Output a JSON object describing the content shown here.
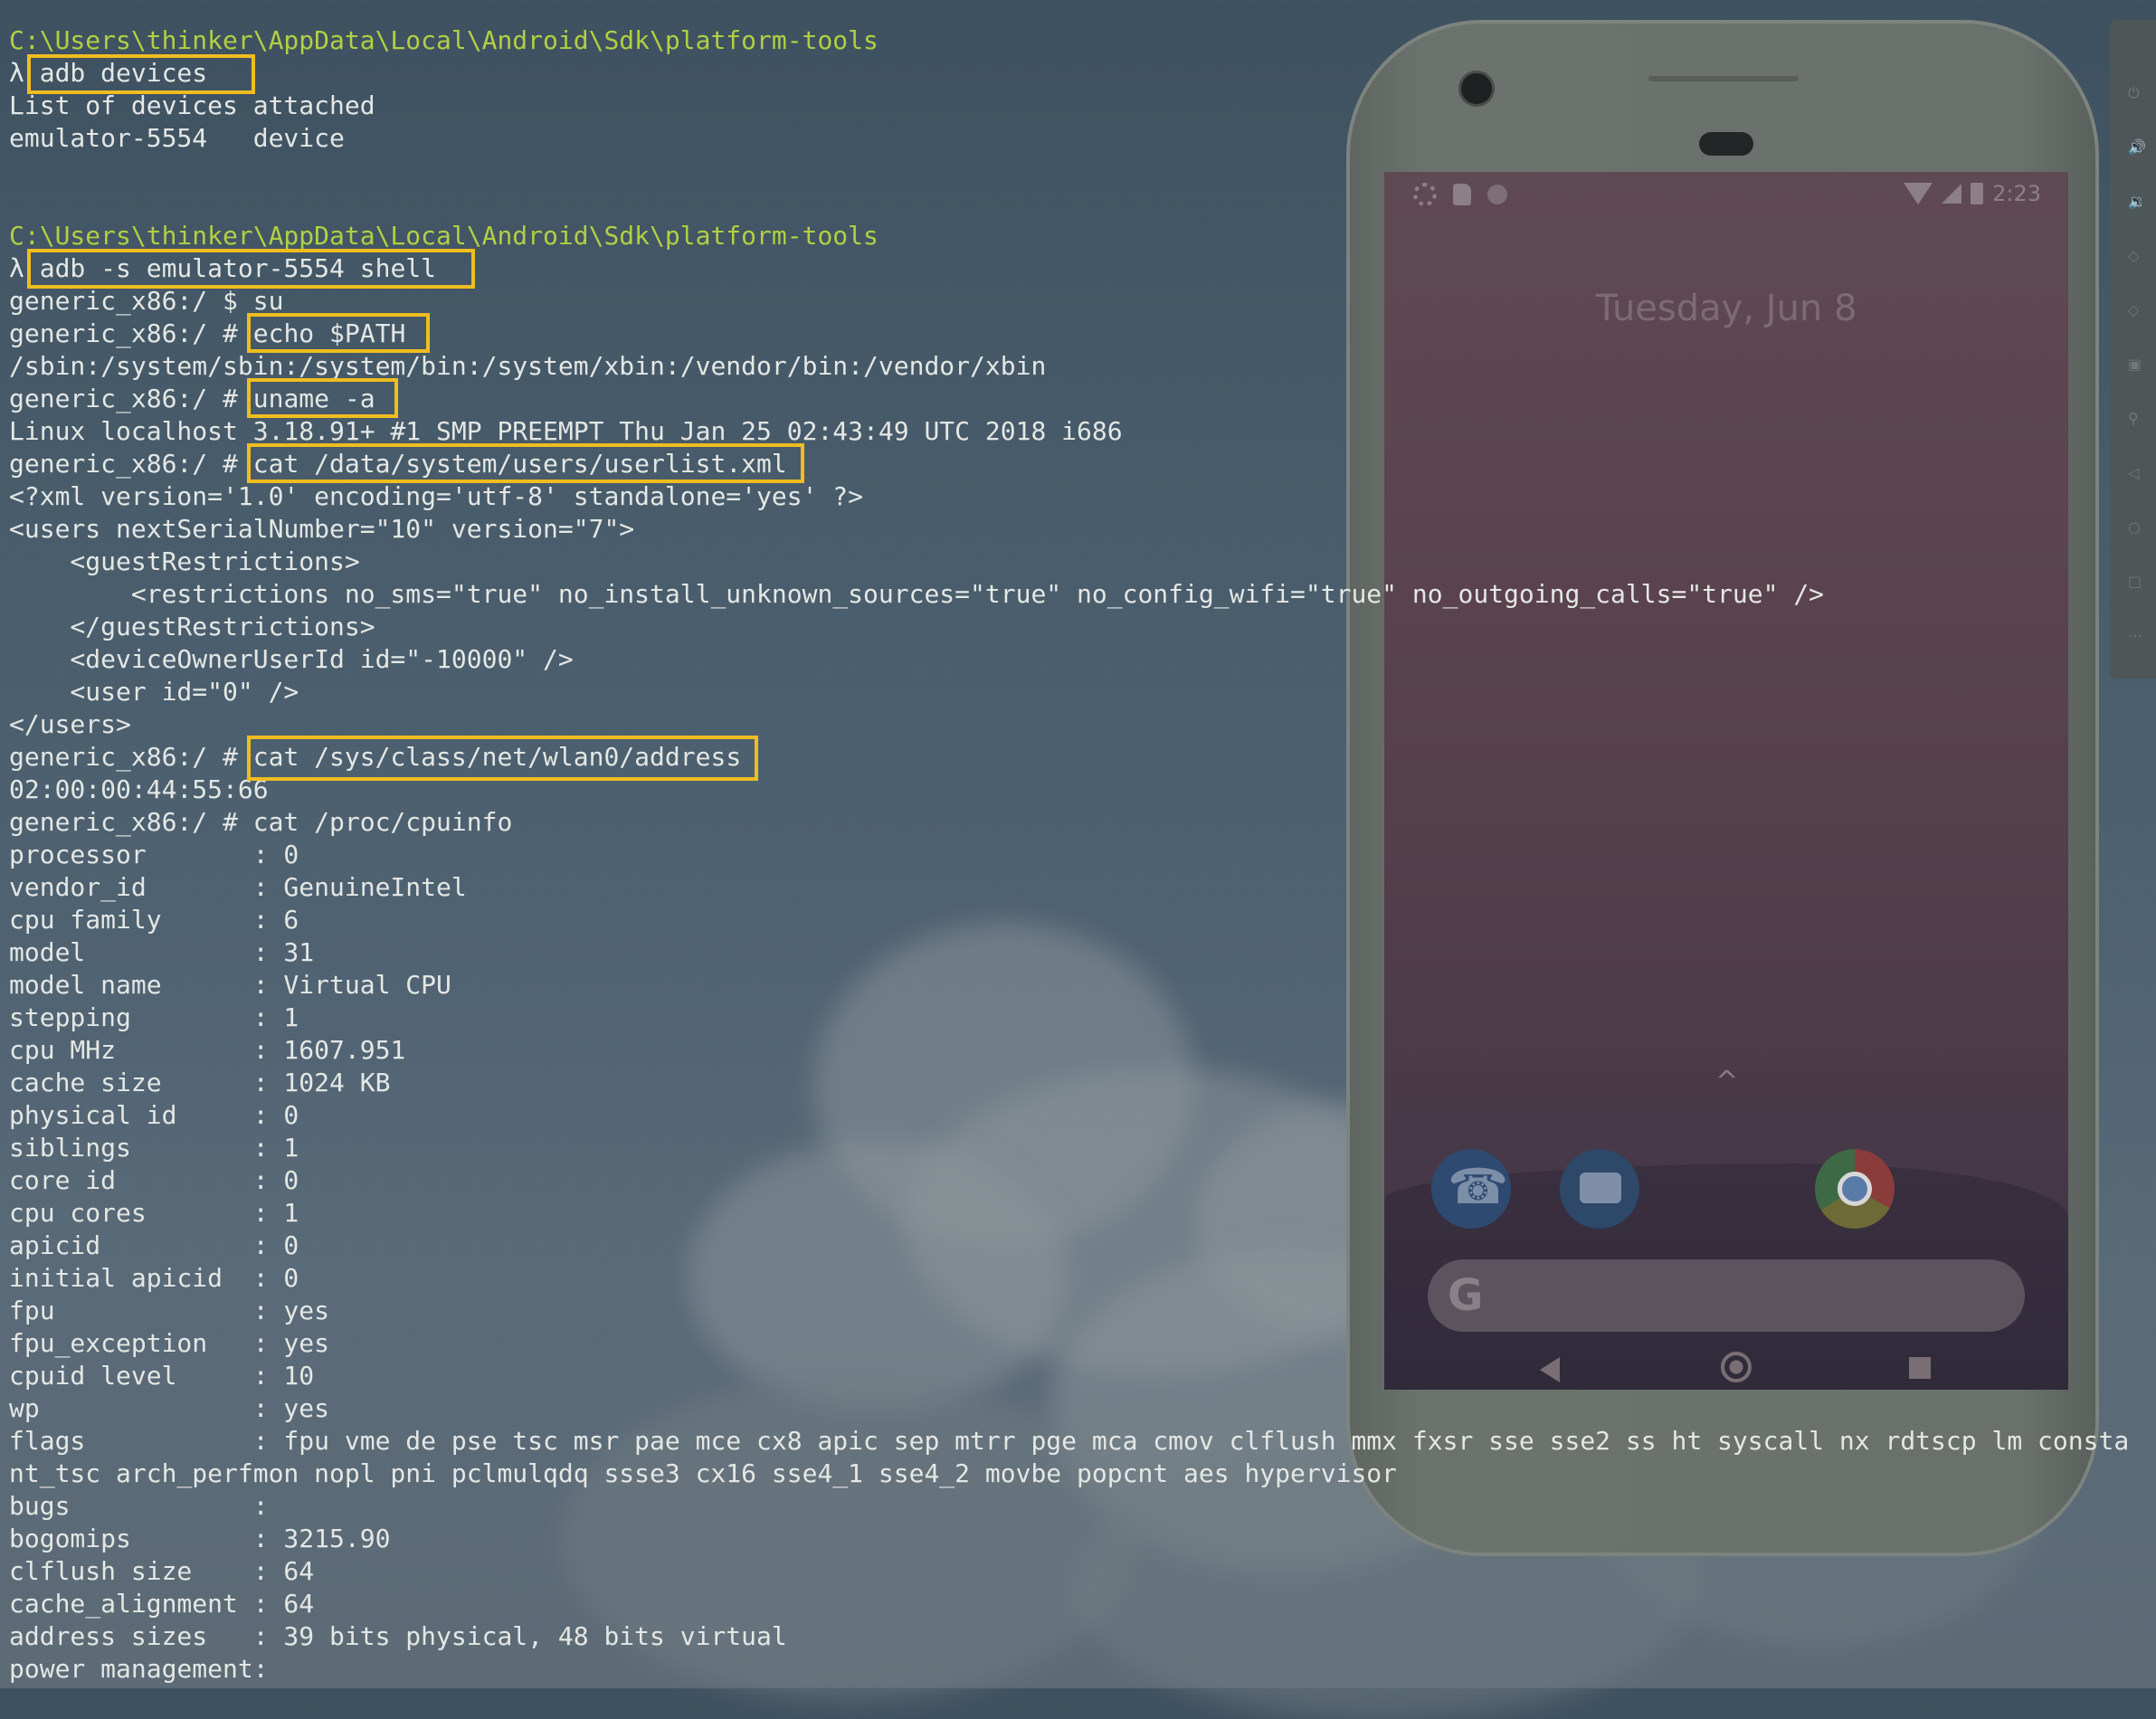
{
  "terminal": {
    "prompt_path": "C:\\Users\\thinker\\AppData\\Local\\Android\\Sdk\\platform-tools",
    "lambda": "λ",
    "commands": {
      "adb_devices": "adb devices",
      "adb_shell": "adb -s emulator-5554 shell",
      "echo_path": "echo $PATH",
      "uname": "uname -a",
      "cat_userlist": "cat /data/system/users/userlist.xml",
      "cat_wlan": "cat /sys/class/net/wlan0/address"
    },
    "prompts": {
      "user": "generic_x86:/ $ su",
      "root": "generic_x86:/ #"
    },
    "output": {
      "devices_header": "List of devices attached",
      "devices_row": "emulator-5554   device",
      "path_value": "/sbin:/system/sbin:/system/bin:/system/xbin:/vendor/bin:/vendor/xbin",
      "uname_value": "Linux localhost 3.18.91+ #1 SMP PREEMPT Thu Jan 25 02:43:49 UTC 2018 i686",
      "xml_lines": [
        "<?xml version='1.0' encoding='utf-8' standalone='yes' ?>",
        "<users nextSerialNumber=\"10\" version=\"7\">",
        "    <guestRestrictions>",
        "        <restrictions no_sms=\"true\" no_install_unknown_sources=\"true\" no_config_wifi=\"true\" no_outgoing_calls=\"true\" />",
        "    </guestRestrictions>",
        "    <deviceOwnerUserId id=\"-10000\" />",
        "    <user id=\"0\" />",
        "</users>"
      ],
      "mac_address": "02:00:00:44:55:66",
      "cpuinfo_cmd": "generic_x86:/ # cat /proc/cpuinfo",
      "cpuinfo_lines": [
        "processor       : 0",
        "vendor_id       : GenuineIntel",
        "cpu family      : 6",
        "model           : 31",
        "model name      : Virtual CPU",
        "stepping        : 1",
        "cpu MHz         : 1607.951",
        "cache size      : 1024 KB",
        "physical id     : 0",
        "siblings        : 1",
        "core id         : 0",
        "cpu cores       : 1",
        "apicid          : 0",
        "initial apicid  : 0",
        "fpu             : yes",
        "fpu_exception   : yes",
        "cpuid level     : 10",
        "wp              : yes",
        "flags           : fpu vme de pse tsc msr pae mce cx8 apic sep mtrr pge mca cmov clflush mmx fxsr sse sse2 ss ht syscall nx rdtscp lm consta",
        "nt_tsc arch_perfmon nopl pni pclmulqdq ssse3 cx16 sse4_1 sse4_2 movbe popcnt aes hypervisor",
        "bugs            :",
        "bogomips        : 3215.90",
        "clflush size    : 64",
        "cache_alignment : 64",
        "address sizes   : 39 bits physical, 48 bits virtual",
        "power management:"
      ]
    }
  },
  "emulator": {
    "status_time": "2:23",
    "lock_date": "Tuesday, Jun 8",
    "caret": "^",
    "search_logo": "G",
    "icons": [
      "phone-icon",
      "messages-icon",
      "chrome-icon",
      "google-search-icon",
      "back-icon",
      "home-icon",
      "recents-icon",
      "settings-icon",
      "sd-card-icon",
      "wifi-icon",
      "signal-icon",
      "battery-icon"
    ]
  },
  "colors": {
    "box_highlight": "#f0bd1e",
    "path_text": "#b2cf43",
    "terminal_text": "#e4e7e4"
  }
}
